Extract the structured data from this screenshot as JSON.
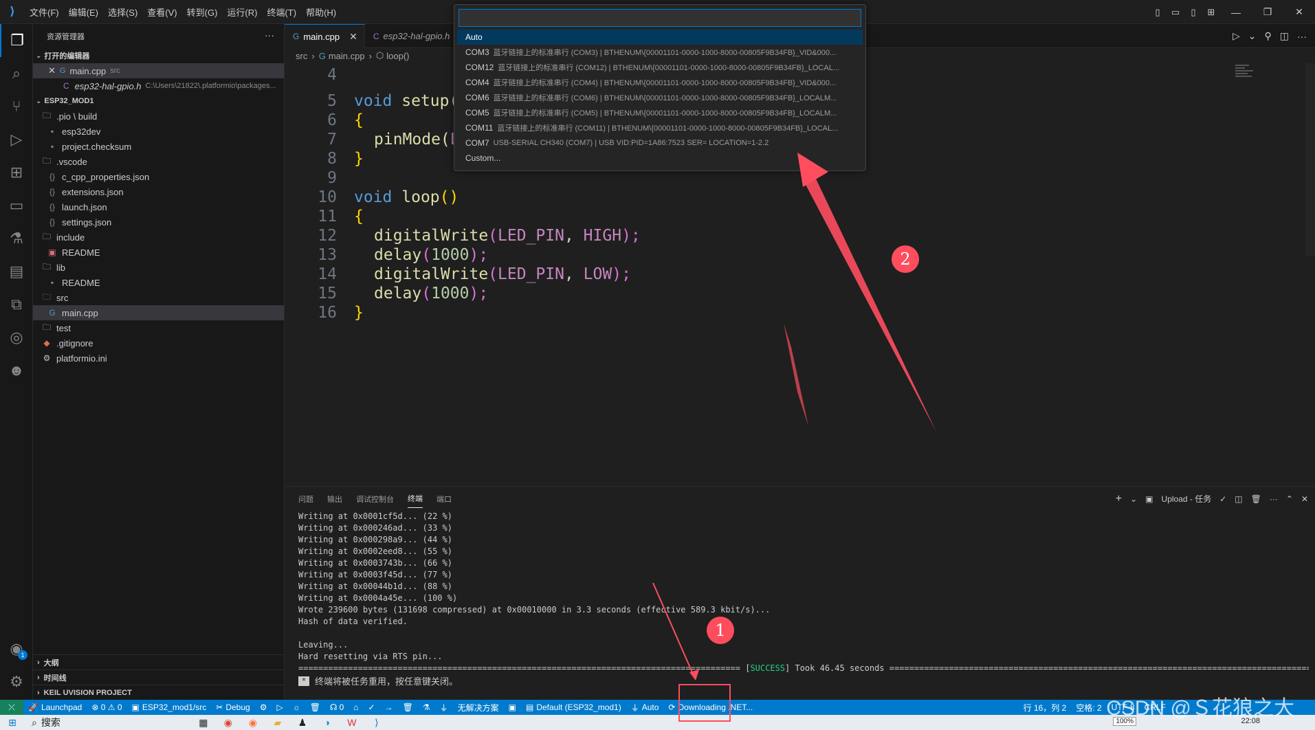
{
  "titlebar": {
    "menu": [
      "文件(F)",
      "编辑(E)",
      "选择(S)",
      "查看(V)",
      "转到(G)",
      "运行(R)",
      "终端(T)",
      "帮助(H)"
    ]
  },
  "sidebar": {
    "title": "资源管理器",
    "more": "···",
    "open_editors_label": "打开的编辑器",
    "open_editors": [
      {
        "name": "main.cpp",
        "desc": "src"
      },
      {
        "name": "esp32-hal-gpio.h",
        "desc": "C:\\Users\\21822\\.platformio\\packages..."
      }
    ],
    "project_label": "ESP32_MOD1",
    "tree": [
      {
        "name": ".pio \\ build"
      },
      {
        "name": "esp32dev"
      },
      {
        "name": "project.checksum"
      },
      {
        "name": ".vscode"
      },
      {
        "name": "c_cpp_properties.json"
      },
      {
        "name": "extensions.json"
      },
      {
        "name": "launch.json"
      },
      {
        "name": "settings.json"
      },
      {
        "name": "include"
      },
      {
        "name": "README"
      },
      {
        "name": "lib"
      },
      {
        "name": "README"
      },
      {
        "name": "src"
      },
      {
        "name": "main.cpp"
      },
      {
        "name": "test"
      },
      {
        "name": ".gitignore"
      },
      {
        "name": "platformio.ini"
      }
    ],
    "bottom_sections": [
      "大纲",
      "时间线",
      "KEIL UVISION PROJECT"
    ]
  },
  "editor": {
    "tabs": [
      {
        "label": "main.cpp"
      },
      {
        "label": "esp32-hal-gpio.h"
      }
    ],
    "breadcrumb": [
      "src",
      "main.cpp",
      "loop()"
    ],
    "line_numbers": [
      "4",
      "5",
      "6",
      "7",
      "8",
      "9",
      "10",
      "11",
      "12",
      "13",
      "14",
      "15",
      "16"
    ],
    "code": {
      "l5_kw": "void",
      "l5_fn": "setup(",
      "l6": "{",
      "l7_fn": "pinMode(",
      "l7_arg": "L",
      "l8": "}",
      "l10_kw": "void",
      "l10_fn": "loop",
      "l10_paren": "()",
      "l11": "{",
      "l12_fn": "digitalWrite",
      "l12_open": "(",
      "l12_a": "LED_PIN",
      "l12_c": ", ",
      "l12_b": "HIGH",
      "l12_close": ");",
      "l13_fn": "delay",
      "l13_open": "(",
      "l13_n": "1000",
      "l13_close": ");",
      "l14_fn": "digitalWrite",
      "l14_open": "(",
      "l14_a": "LED_PIN",
      "l14_c": ", ",
      "l14_b": "LOW",
      "l14_close": ");",
      "l15_fn": "delay",
      "l15_open": "(",
      "l15_n": "1000",
      "l15_close": ");",
      "l16": "}"
    }
  },
  "quickpick": {
    "input_value": "",
    "items": [
      {
        "label": "Auto",
        "desc": ""
      },
      {
        "label": "COM3",
        "desc": "蓝牙链接上的标准串行 (COM3) | BTHENUM\\{00001101-0000-1000-8000-00805F9B34FB}_VID&000..."
      },
      {
        "label": "COM12",
        "desc": "蓝牙链接上的标准串行 (COM12) | BTHENUM\\{00001101-0000-1000-8000-00805F9B34FB}_LOCAL..."
      },
      {
        "label": "COM4",
        "desc": "蓝牙链接上的标准串行 (COM4) | BTHENUM\\{00001101-0000-1000-8000-00805F9B34FB}_VID&000..."
      },
      {
        "label": "COM6",
        "desc": "蓝牙链接上的标准串行 (COM6) | BTHENUM\\{00001101-0000-1000-8000-00805F9B34FB}_LOCALM..."
      },
      {
        "label": "COM5",
        "desc": "蓝牙链接上的标准串行 (COM5) | BTHENUM\\{00001101-0000-1000-8000-00805F9B34FB}_LOCALM..."
      },
      {
        "label": "COM11",
        "desc": "蓝牙链接上的标准串行 (COM11) | BTHENUM\\{00001101-0000-1000-8000-00805F9B34FB}_LOCAL..."
      },
      {
        "label": "COM7",
        "desc": "USB-SERIAL CH340 (COM7) | USB VID:PID=1A86:7523 SER= LOCATION=1-2.2"
      },
      {
        "label": "Custom...",
        "desc": ""
      }
    ]
  },
  "panel": {
    "tabs": [
      "问题",
      "输出",
      "调试控制台",
      "终端",
      "端口"
    ],
    "task_label": "Upload - 任务",
    "terminal_lines": [
      "Writing at 0x0001cf5d... (22 %)",
      "Writing at 0x000246ad... (33 %)",
      "Writing at 0x000298a9... (44 %)",
      "Writing at 0x0002eed8... (55 %)",
      "Writing at 0x0003743b... (66 %)",
      "Writing at 0x0003f45d... (77 %)",
      "Writing at 0x00044b1d... (88 %)",
      "Writing at 0x0004a45e... (100 %)",
      "Wrote 239600 bytes (131698 compressed) at 0x00010000 in 3.3 seconds (effective 589.3 kbit/s)...",
      "Hash of data verified.",
      "",
      "Leaving...",
      "Hard resetting via RTS pin..."
    ],
    "success_left": "========================================================================================= [",
    "success_word": "SUCCESS",
    "success_right": "] Took 46.45 seconds ================================================================================================================",
    "reuse_note": "终端将被任务重用，按任意键关闭。"
  },
  "statusbar": {
    "launchpad": "Launchpad",
    "problems": "⊗ 0 ⚠ 0",
    "project": "ESP32_mod1/src",
    "debug": "Debug",
    "ports": "0",
    "unresolved": "无解决方案",
    "env": "Default (ESP32_mod1)",
    "port_auto": "Auto",
    "downloading": "Downloading .NET...",
    "position": "行 16，列 2",
    "spaces": "空格: 2",
    "encoding": "UTF-8",
    "eol": "CRLF"
  },
  "taskbar": {
    "search": "搜索",
    "clock": "22:08",
    "zoom": "100%"
  },
  "annotations": {
    "one": "1",
    "two": "2",
    "watermark": "CSDN @Ｓ花狼之大"
  },
  "colors": {
    "accent": "#0078d4",
    "statusbar": "#007acc",
    "annotation": "#ff4d5e"
  }
}
